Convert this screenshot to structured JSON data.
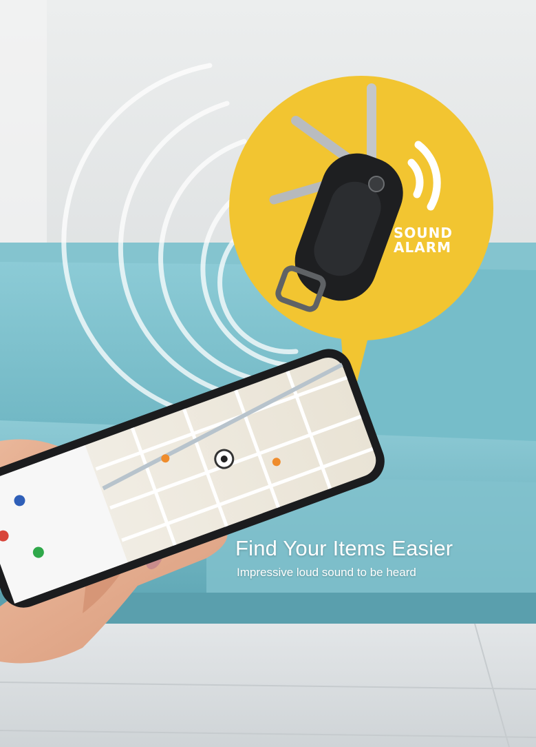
{
  "badge": {
    "line1": "SOUND",
    "line2": "ALARM"
  },
  "headline": "Find Your Items Easier",
  "subheadline": "Impressive loud sound to be heard",
  "colors": {
    "wall": "#e4e6e7",
    "sofa": "#7fc3cf",
    "badge_yellow": "#f2c531",
    "floor": "#d9dde0"
  },
  "icons": [
    "sound-wave-icon",
    "key-organizer-image",
    "smartphone-map-image"
  ]
}
